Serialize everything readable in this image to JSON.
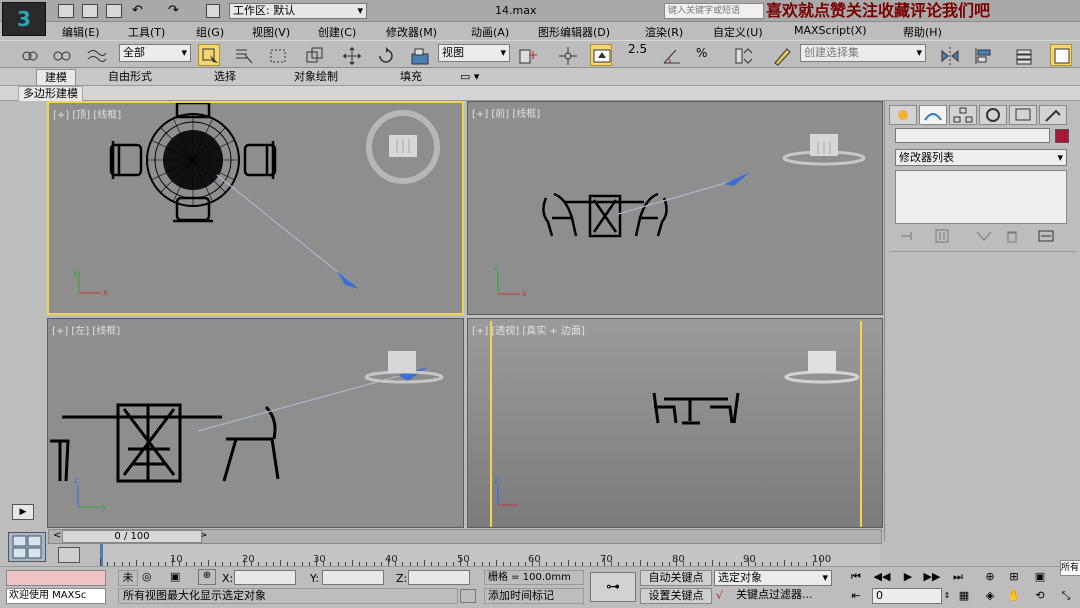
{
  "titlebar": {
    "workspace_label": "工作区: 默认",
    "filename": "14.max",
    "search_placeholder": "键入关键字或短语",
    "banner": "喜欢就点赞关注收藏评论我们吧"
  },
  "menubar": {
    "items": [
      "编辑(E)",
      "工具(T)",
      "组(G)",
      "视图(V)",
      "创建(C)",
      "修改器(M)",
      "动画(A)",
      "图形编辑器(D)",
      "渲染(R)",
      "自定义(U)",
      "MAXScript(X)",
      "帮助(H)"
    ]
  },
  "toolbar": {
    "filter_value": "全部",
    "refcoord_value": "视图",
    "snap_label": "2.5",
    "named_selection_placeholder": "创建选择集"
  },
  "ribbon": {
    "tabs": [
      "建模",
      "自由形式",
      "选择",
      "对象绘制",
      "填充"
    ],
    "selected_tab": 0,
    "subtab": "多边形建模"
  },
  "viewports": [
    {
      "label": "[+] [顶] [线框]",
      "active": true
    },
    {
      "label": "[+] [前] [线框]",
      "active": false
    },
    {
      "label": "[+] [左] [线框]",
      "active": false
    },
    {
      "label": "[+] [透视] [真实 + 边面]",
      "active": false
    }
  ],
  "command_panel": {
    "modifier_list": "修改器列表",
    "object_color": "#a8163a"
  },
  "timeslider": {
    "position_label": "0 / 100",
    "ticks": [
      "0",
      "10",
      "20",
      "30",
      "40",
      "50",
      "60",
      "70",
      "80",
      "90",
      "100"
    ]
  },
  "status": {
    "selection_label": "未",
    "x_label": "X:",
    "y_label": "Y:",
    "z_label": "Z:",
    "grid": "栅格 = 100.0mm",
    "welcome": "欢迎使用 MAXSc",
    "prompt": "所有视图最大化显示选定对象",
    "add_time_tag": "添加时间标记",
    "auto_key": "自动关键点",
    "set_key": "设置关键点",
    "selected_objects": "选定对象",
    "key_filters": "关键点过滤器...",
    "current_frame": "0",
    "tooltip": "所有"
  }
}
